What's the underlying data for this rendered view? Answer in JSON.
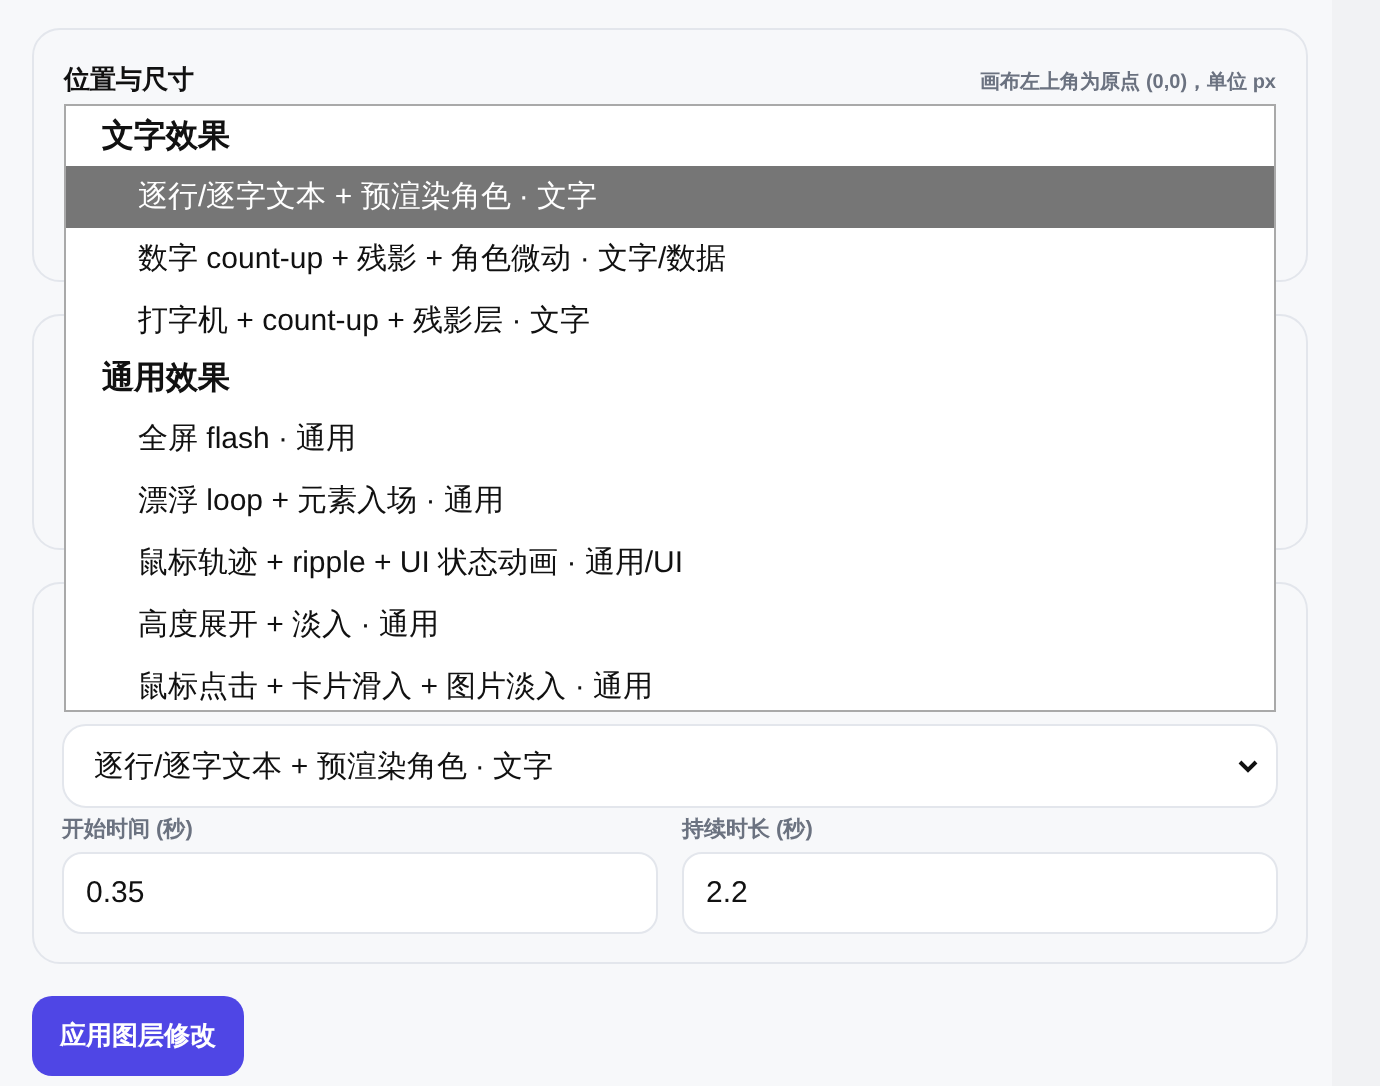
{
  "panel": {
    "title": "位置与尺寸",
    "hint": "画布左上角为原点 (0,0)，单位 px"
  },
  "dropdown": {
    "groups": [
      {
        "label": "文字效果",
        "options": [
          {
            "label": "逐行/逐字文本 + 预渲染角色 · 文字",
            "selected": true
          },
          {
            "label": "数字 count-up + 残影 + 角色微动 · 文字/数据",
            "selected": false
          },
          {
            "label": "打字机 + count-up + 残影层 · 文字",
            "selected": false
          }
        ]
      },
      {
        "label": "通用效果",
        "options": [
          {
            "label": "全屏 flash · 通用",
            "selected": false
          },
          {
            "label": "漂浮 loop + 元素入场 · 通用",
            "selected": false
          },
          {
            "label": "鼠标轨迹 + ripple + UI 状态动画 · 通用/UI",
            "selected": false
          },
          {
            "label": "高度展开 + 淡入 · 通用",
            "selected": false
          },
          {
            "label": "鼠标点击 + 卡片滑入 + 图片淡入 · 通用",
            "selected": false
          }
        ]
      }
    ]
  },
  "effect_select": {
    "value": "逐行/逐字文本 + 预渲染角色 · 文字"
  },
  "fields": [
    {
      "label": "开始时间 (秒)",
      "value": "0.35"
    },
    {
      "label": "持续时长 (秒)",
      "value": "2.2"
    }
  ],
  "apply_button": "应用图层修改"
}
